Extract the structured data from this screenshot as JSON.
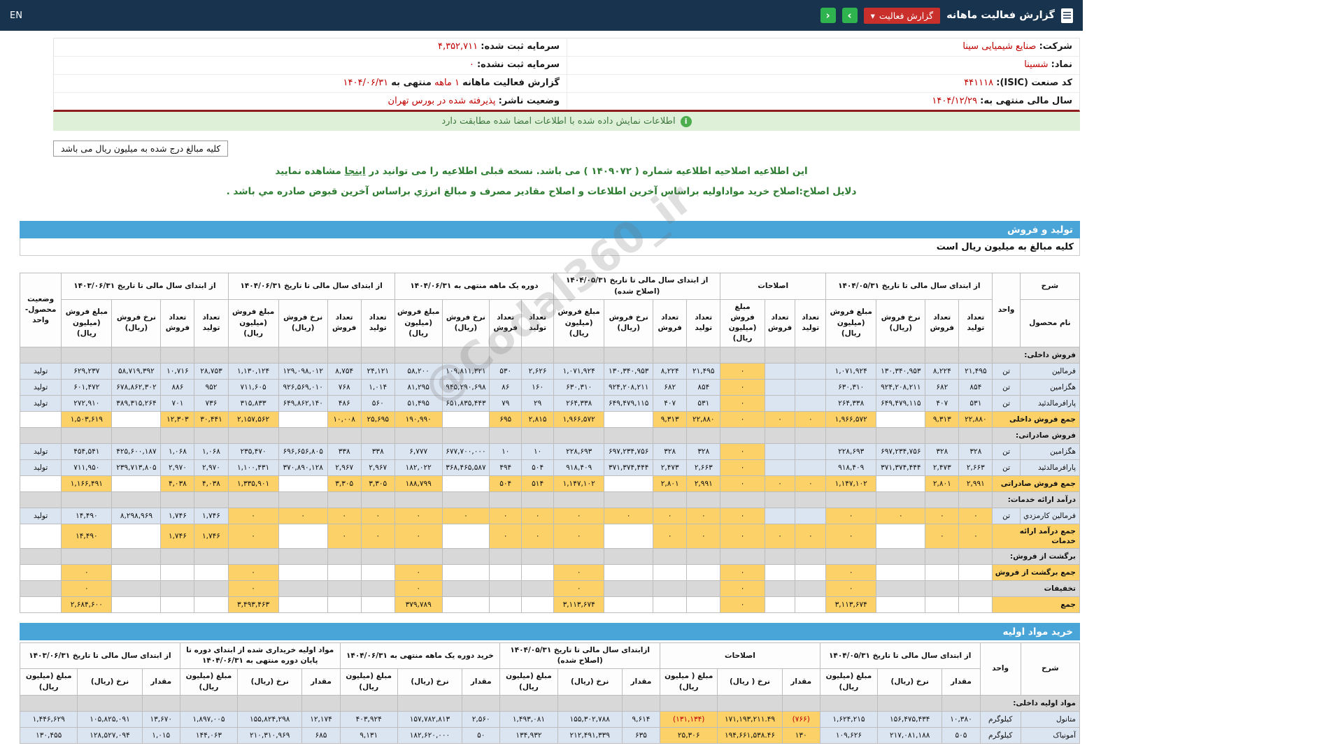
{
  "topbar": {
    "title": "گزارش فعالیت ماهانه",
    "badge_label": "گزارش فعالیت",
    "badge_caret": "▾",
    "nav_right": "›",
    "nav_left": "‹",
    "lang_link": "EN"
  },
  "company_info": {
    "rows": [
      {
        "right": [
          [
            "شرکت:",
            "l"
          ],
          [
            "صنایع شیمیایی سینا",
            "v"
          ]
        ],
        "left": [
          [
            "سرمایه ثبت شده:",
            "l"
          ],
          [
            "۴,۳۵۲,۷۱۱",
            "v"
          ]
        ]
      },
      {
        "right": [
          [
            "نماد:",
            "l"
          ],
          [
            "شسینا",
            "v"
          ]
        ],
        "left": [
          [
            "سرمایه ثبت نشده:",
            "l"
          ],
          [
            "۰",
            "v"
          ]
        ]
      },
      {
        "right": [
          [
            "کد صنعت (ISIC):",
            "l"
          ],
          [
            "۴۴۱۱۱۸",
            "v"
          ]
        ],
        "left": [
          [
            "گزارش فعالیت ماهانه",
            "l"
          ],
          [
            "۱ ماهه",
            "v"
          ],
          [
            "منتهی به",
            "l"
          ],
          [
            "۱۴۰۴/۰۶/۳۱",
            "v"
          ]
        ]
      },
      {
        "right": [
          [
            "سال مالی منتهی به:",
            "l"
          ],
          [
            "۱۴۰۴/۱۲/۲۹",
            "v"
          ]
        ],
        "left": [
          [
            "وضعیت ناشر:",
            "l"
          ],
          [
            "پذیرفته شده در بورس تهران",
            "v"
          ]
        ]
      }
    ]
  },
  "notices": {
    "info_icon": "i",
    "signed_match": "اطلاعات نمایش داده شده با اطلاعات امضا شده مطابقت دارد",
    "amounts_box": "کلیه مبالغ درج شده به میلیون ریال می باشد",
    "amendment_pre": "این اطلاعیه اصلاحیه اطلاعیه شماره ( ۱۴۰۹۰۷۲ ) می باشد. نسخه قبلی اطلاعیه را می توانید در",
    "amendment_link": "اینجا",
    "amendment_post": "مشاهده نمایید",
    "amendment_reason": "دلایل اصلاح:اصلاح خرید مواداولیه براساس آخرین اطلاعات و اصلاح مقادیر مصرف و مبالغ انرژي براساس آخرین قبوض صادره مي باشد ."
  },
  "watermark": "@Codal360_ir",
  "sales_section": {
    "title": "تولید و فروش",
    "subtitle": "کلیه مبالغ به میلیون ریال است"
  },
  "materials_section": {
    "title": "خرید مواد اولیه"
  },
  "sales_table": {
    "eslahat_cols": [
      4,
      5,
      6
    ],
    "header": {
      "sharh": "شرح",
      "name_col": "نام محصول",
      "unit_col": "واحد",
      "status_col": "وضعیت محصول-واحد",
      "groups": [
        {
          "label": "از ابتدای سال مالی تا تاریخ ۱۴۰۴/۰۵/۳۱",
          "cols": [
            "تعداد تولید",
            "تعداد فروش",
            "نرخ فروش (ریال)",
            "مبلغ فروش (میلیون ریال)"
          ]
        },
        {
          "label": "اصلاحات",
          "cols": [
            "تعداد تولید",
            "تعداد فروش",
            "مبلغ فروش (میلیون ریال)"
          ]
        },
        {
          "label": "از ابتدای سال مالی تا تاریخ ۱۴۰۴/۰۵/۳۱ (اصلاح شده)",
          "cols": [
            "تعداد تولید",
            "تعداد فروش",
            "نرخ فروش (ریال)",
            "مبلغ فروش (میلیون ریال)"
          ]
        },
        {
          "label": "دوره یک ماهه منتهی به ۱۴۰۴/۰۶/۳۱",
          "cols": [
            "تعداد تولید",
            "تعداد فروش",
            "نرخ فروش (ریال)",
            "مبلغ فروش (میلیون ریال)"
          ]
        },
        {
          "label": "از ابتدای سال مالی تا تاریخ ۱۴۰۴/۰۶/۳۱",
          "cols": [
            "تعداد تولید",
            "تعداد فروش",
            "نرخ فروش (ریال)",
            "مبلغ فروش (میلیون ریال)"
          ]
        },
        {
          "label": "از ابتدای سال مالی تا تاریخ ۱۴۰۳/۰۶/۳۱",
          "cols": [
            "تعداد تولید",
            "تعداد فروش",
            "نرخ فروش (ریال)",
            "مبلغ فروش (میلیون ریال)"
          ]
        }
      ]
    },
    "rows": [
      {
        "type": "category",
        "label": "فروش داخلی:"
      },
      {
        "type": "product",
        "name": "فرمالین",
        "unit": "تن",
        "status": "تولید",
        "cells": [
          "۲۱,۴۹۵",
          "۸,۲۲۴",
          "۱۳۰,۳۴۰,۹۵۳",
          "۱,۰۷۱,۹۲۴",
          "",
          "",
          "۰",
          "۲۱,۴۹۵",
          "۸,۲۲۴",
          "۱۳۰,۳۴۰,۹۵۳",
          "۱,۰۷۱,۹۲۴",
          "۲,۶۲۶",
          "۵۳۰",
          "۱۰۹,۸۱۱,۳۲۱",
          "۵۸,۲۰۰",
          "۲۴,۱۲۱",
          "۸,۷۵۴",
          "۱۲۹,۰۹۸,۰۱۲",
          "۱,۱۳۰,۱۲۴",
          "۲۸,۷۵۳",
          "۱۰,۷۱۶",
          "۵۸,۷۱۹,۳۹۲",
          "۶۲۹,۲۳۷"
        ]
      },
      {
        "type": "product",
        "name": "هگزامین",
        "unit": "تن",
        "status": "تولید",
        "cells": [
          "۸۵۴",
          "۶۸۲",
          "۹۲۴,۲۰۸,۲۱۱",
          "۶۳۰,۳۱۰",
          "",
          "",
          "۰",
          "۸۵۴",
          "۶۸۲",
          "۹۲۴,۲۰۸,۲۱۱",
          "۶۳۰,۳۱۰",
          "۱۶۰",
          "۸۶",
          "۹۴۵,۲۹۰,۶۹۸",
          "۸۱,۲۹۵",
          "۱,۰۱۴",
          "۷۶۸",
          "۹۲۶,۵۶۹,۰۱۰",
          "۷۱۱,۶۰۵",
          "۹۵۲",
          "۸۸۶",
          "۶۷۸,۸۶۲,۳۰۲",
          "۶۰۱,۴۷۲"
        ]
      },
      {
        "type": "product",
        "name": "پارافرمالدئید",
        "unit": "تن",
        "status": "تولید",
        "cells": [
          "۵۳۱",
          "۴۰۷",
          "۶۴۹,۴۷۹,۱۱۵",
          "۲۶۴,۳۳۸",
          "",
          "",
          "۰",
          "۵۳۱",
          "۴۰۷",
          "۶۴۹,۴۷۹,۱۱۵",
          "۲۶۴,۳۳۸",
          "۲۹",
          "۷۹",
          "۶۵۱,۸۳۵,۴۴۳",
          "۵۱,۴۹۵",
          "۵۶۰",
          "۴۸۶",
          "۶۴۹,۸۶۲,۱۴۰",
          "۳۱۵,۸۳۳",
          "۷۳۶",
          "۷۰۱",
          "۳۸۹,۳۱۵,۲۶۴",
          "۲۷۲,۹۱۰"
        ]
      },
      {
        "type": "total",
        "label": "جمع فروش داخلی",
        "cells": [
          "۲۲,۸۸۰",
          "۹,۳۱۳",
          "",
          "۱,۹۶۶,۵۷۲",
          "۰",
          "۰",
          "۰",
          "۲۲,۸۸۰",
          "۹,۳۱۳",
          "",
          "۱,۹۶۶,۵۷۲",
          "۲,۸۱۵",
          "۶۹۵",
          "",
          "۱۹۰,۹۹۰",
          "۲۵,۶۹۵",
          "۱۰,۰۰۸",
          "",
          "۲,۱۵۷,۵۶۲",
          "۳۰,۴۴۱",
          "۱۲,۳۰۳",
          "",
          "۱,۵۰۳,۶۱۹"
        ]
      },
      {
        "type": "category",
        "label": "فروش صادراتی:"
      },
      {
        "type": "product",
        "name": "هگزامین",
        "unit": "تن",
        "status": "تولید",
        "cells": [
          "۳۲۸",
          "۳۲۸",
          "۶۹۷,۲۳۴,۷۵۶",
          "۲۲۸,۶۹۳",
          "",
          "",
          "۰",
          "۳۲۸",
          "۳۲۸",
          "۶۹۷,۲۳۴,۷۵۶",
          "۲۲۸,۶۹۳",
          "۱۰",
          "۱۰",
          "۶۷۷,۷۰۰,۰۰۰",
          "۶,۷۷۷",
          "۳۳۸",
          "۳۳۸",
          "۶۹۶,۶۵۶,۸۰۵",
          "۲۳۵,۴۷۰",
          "۱,۰۶۸",
          "۱,۰۶۸",
          "۴۲۵,۶۰۰,۱۸۷",
          "۴۵۴,۵۴۱"
        ]
      },
      {
        "type": "product",
        "name": "پارافرمالدئید",
        "unit": "تن",
        "status": "تولید",
        "cells": [
          "۲,۶۶۳",
          "۲,۴۷۳",
          "۳۷۱,۳۷۴,۴۴۴",
          "۹۱۸,۴۰۹",
          "",
          "",
          "۰",
          "۲,۶۶۳",
          "۲,۴۷۳",
          "۳۷۱,۳۷۴,۴۴۴",
          "۹۱۸,۴۰۹",
          "۵۰۴",
          "۴۹۴",
          "۳۶۸,۴۶۵,۵۸۷",
          "۱۸۲,۰۲۲",
          "۲,۹۶۷",
          "۲,۹۶۷",
          "۳۷۰,۸۹۰,۱۲۸",
          "۱,۱۰۰,۴۳۱",
          "۲,۹۷۰",
          "۲,۹۷۰",
          "۲۳۹,۷۱۳,۸۰۵",
          "۷۱۱,۹۵۰"
        ]
      },
      {
        "type": "total",
        "label": "جمع فروش صادراتی",
        "cells": [
          "۲,۹۹۱",
          "۲,۸۰۱",
          "",
          "۱,۱۴۷,۱۰۲",
          "۰",
          "۰",
          "۰",
          "۲,۹۹۱",
          "۲,۸۰۱",
          "",
          "۱,۱۴۷,۱۰۲",
          "۵۱۴",
          "۵۰۴",
          "",
          "۱۸۸,۷۹۹",
          "۳,۳۰۵",
          "۳,۳۰۵",
          "",
          "۱,۳۳۵,۹۰۱",
          "۴,۰۳۸",
          "۴,۰۳۸",
          "",
          "۱,۱۶۶,۴۹۱"
        ]
      },
      {
        "type": "category",
        "label": "درآمد ارائه خدمات:"
      },
      {
        "type": "product",
        "name": "فرمالین کارمزدي",
        "unit": "تن",
        "status": "تولید",
        "cells": [
          "۰",
          "۰",
          "۰",
          "۰",
          "",
          "",
          "۰",
          "۰",
          "۰",
          "۰",
          "۰",
          "۰",
          "۰",
          "۰",
          "۰",
          "۰",
          "۰",
          "۰",
          "۰",
          "۱,۷۴۶",
          "۱,۷۴۶",
          "۸,۲۹۸,۹۶۹",
          "۱۴,۴۹۰"
        ]
      },
      {
        "type": "total",
        "label": "جمع درآمد ارائه خدمات",
        "cells": [
          "۰",
          "۰",
          "",
          "۰",
          "۰",
          "۰",
          "۰",
          "۰",
          "۰",
          "",
          "۰",
          "۰",
          "۰",
          "",
          "۰",
          "۰",
          "۰",
          "",
          "۰",
          "۱,۷۴۶",
          "۱,۷۴۶",
          "",
          "۱۴,۴۹۰"
        ]
      },
      {
        "type": "category",
        "label": "برگشت از فروش:"
      },
      {
        "type": "total",
        "label": "جمع برگشت از فروش",
        "cells": [
          "",
          "",
          "",
          "۰",
          "",
          "",
          "۰",
          "",
          "",
          "",
          "۰",
          "",
          "",
          "",
          "۰",
          "",
          "",
          "",
          "۰",
          "",
          "",
          "",
          "۰"
        ]
      },
      {
        "type": "misc",
        "label": "تخفیفات",
        "cells": [
          "",
          "",
          "",
          "۰",
          "",
          "",
          "۰",
          "",
          "",
          "",
          "۰",
          "",
          "",
          "",
          "۰",
          "",
          "",
          "",
          "۰",
          "",
          "",
          "",
          "۰"
        ]
      },
      {
        "type": "total",
        "label": "جمع",
        "cells": [
          "",
          "",
          "",
          "۳,۱۱۳,۶۷۴",
          "",
          "",
          "۰",
          "",
          "",
          "",
          "۳,۱۱۳,۶۷۴",
          "",
          "",
          "",
          "۳۷۹,۷۸۹",
          "",
          "",
          "",
          "۳,۴۹۳,۴۶۳",
          "",
          "",
          "",
          "۲,۶۸۴,۶۰۰"
        ]
      }
    ]
  },
  "materials_table": {
    "eslahat_cols": [
      3,
      4,
      5
    ],
    "header": {
      "sharh": "شرح",
      "unit_col": "واحد",
      "groups": [
        {
          "label": "از ابتدای سال مالی تا تاریخ ۱۴۰۴/۰۵/۳۱",
          "cols": [
            "مقدار",
            "نرخ (ریال)",
            "مبلغ (میلیون ریال)"
          ]
        },
        {
          "label": "اصلاحات",
          "cols": [
            "مقدار",
            "نرخ ( ریال)",
            "مبلغ ( میلیون ریال)"
          ]
        },
        {
          "label": "ازابتدای سال مالی تا تاریخ ۱۴۰۴/۰۵/۳۱ (اصلاح شده)",
          "cols": [
            "مقدار",
            "نرخ (ریال)",
            "مبلغ (میلیون ریال)"
          ]
        },
        {
          "label": "خرید دوره یک ماهه منتهی به ۱۴۰۴/۰۶/۳۱",
          "cols": [
            "مقدار",
            "نرخ (ریال)",
            "مبلغ (میلیون ریال)"
          ]
        },
        {
          "label": "مواد اولیه خریداری شده از ابتدای دوره تا پایان دوره منتهی به ۱۴۰۴/۰۶/۳۱",
          "cols": [
            "مقدار",
            "نرخ (ریال)",
            "مبلغ (میلیون ریال)"
          ]
        },
        {
          "label": "از ابتدای سال مالی تا تاریخ ۱۴۰۳/۰۶/۳۱",
          "cols": [
            "مقدار",
            "نرخ (ریال)",
            "مبلغ (میلیون ریال)"
          ]
        }
      ]
    },
    "rows": [
      {
        "type": "category",
        "label": "مواد اولیه داخلی:"
      },
      {
        "type": "product",
        "name": "متانول",
        "unit": "کیلوگرم",
        "cells": [
          "۱۰,۳۸۰",
          "۱۵۶,۴۷۵,۴۳۴",
          "۱,۶۲۴,۲۱۵",
          "(۷۶۶)",
          "۱۷۱,۱۹۳,۲۱۱.۴۹",
          "(۱۳۱,۱۳۴)",
          "۹,۶۱۴",
          "۱۵۵,۳۰۲,۷۸۸",
          "۱,۴۹۳,۰۸۱",
          "۲,۵۶۰",
          "۱۵۷,۷۸۲,۸۱۳",
          "۴۰۳,۹۲۴",
          "۱۲,۱۷۴",
          "۱۵۵,۸۲۴,۲۹۸",
          "۱,۸۹۷,۰۰۵",
          "۱۳,۶۷۰",
          "۱۰۵,۸۲۵,۰۹۱",
          "۱,۴۴۶,۶۲۹"
        ]
      },
      {
        "type": "product",
        "name": "آمونیاک",
        "unit": "کیلوگرم",
        "cells": [
          "۵۰۵",
          "۲۱۷,۰۸۱,۱۸۸",
          "۱۰۹,۶۲۶",
          "۱۳۰",
          "۱۹۴,۶۶۱,۵۳۸.۴۶",
          "۲۵,۳۰۶",
          "۶۳۵",
          "۲۱۲,۴۹۱,۳۳۹",
          "۱۳۴,۹۳۲",
          "۵۰",
          "۱۸۲,۶۲۰,۰۰۰",
          "۹,۱۳۱",
          "۶۸۵",
          "۲۱۰,۳۱۰,۹۶۹",
          "۱۴۴,۰۶۳",
          "۱,۰۱۵",
          "۱۲۸,۵۲۷,۰۹۴",
          "۱۳۰,۴۵۵"
        ]
      }
    ]
  }
}
